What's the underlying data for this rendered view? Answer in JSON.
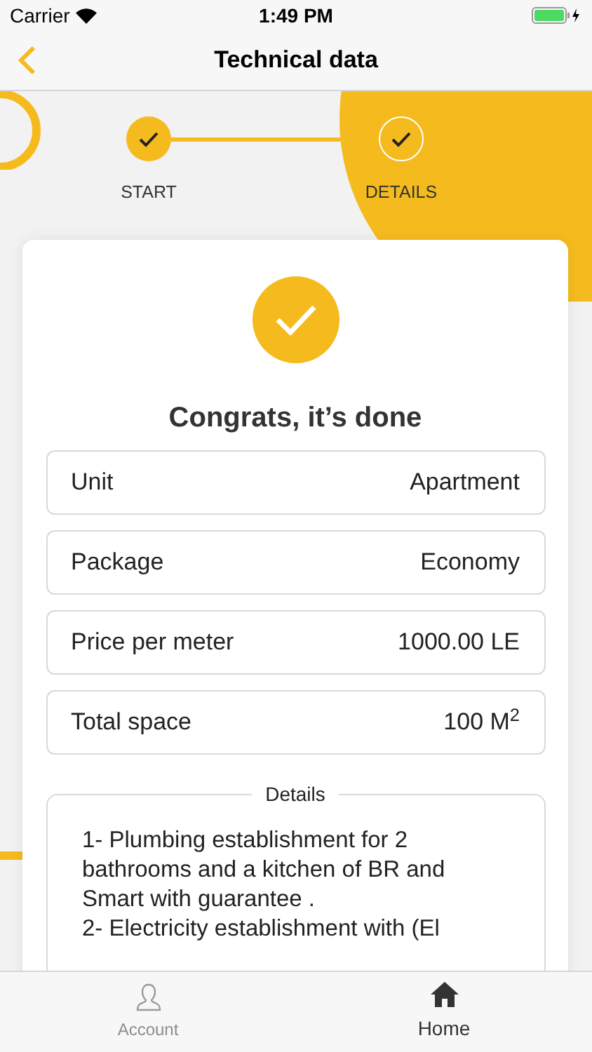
{
  "status_bar": {
    "carrier": "Carrier",
    "time": "1:49 PM"
  },
  "nav": {
    "title": "Technical data"
  },
  "steps": [
    {
      "label": "START",
      "done": true,
      "current": false
    },
    {
      "label": "DETAILS",
      "done": true,
      "current": true
    }
  ],
  "card": {
    "title": "Congrats, it’s done",
    "rows": [
      {
        "label": "Unit",
        "value": "Apartment"
      },
      {
        "label": "Package",
        "value": "Economy"
      },
      {
        "label": "Price per meter",
        "value": "1000.00 LE"
      },
      {
        "label": "Total space",
        "value": "100 M$^{2}$"
      }
    ],
    "details": {
      "legend": "Details",
      "lines": [
        "1- Plumbing establishment for 2 bathrooms and a kitchen of BR and Smart with guarantee .",
        "2- Electricity establishment with (El"
      ]
    }
  },
  "tab_bar": [
    {
      "label": "Account",
      "kind": "account",
      "selected": false
    },
    {
      "label": "Home",
      "kind": "home",
      "selected": true
    }
  ]
}
